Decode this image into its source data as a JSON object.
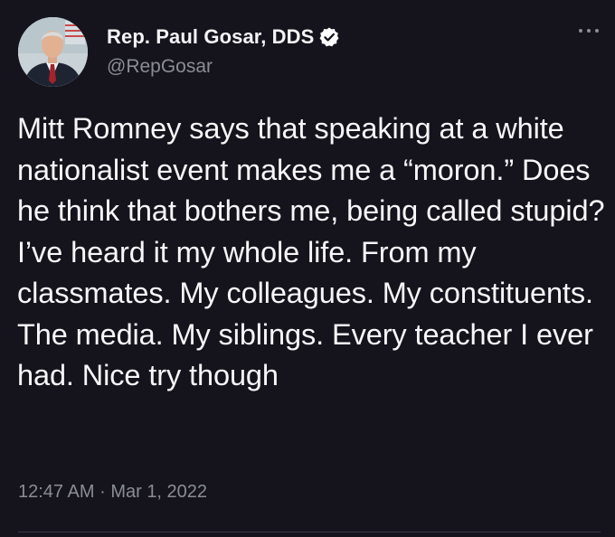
{
  "tweet": {
    "author": {
      "display_name": "Rep. Paul Gosar, DDS",
      "handle": "@RepGosar",
      "verified": true,
      "avatar_icon": "user-avatar-photo"
    },
    "more_icon": "more-options-icon",
    "text": "Mitt Romney says that speaking at a white nationalist event makes me a “moron.” Does he think that bothers me, being called stupid? I’ve heard it my whole life. From my classmates. My colleagues. My constituents. The media. My siblings. Every teacher I ever had. Nice try though",
    "time": "12:47 AM",
    "separator": "·",
    "date": "Mar 1, 2022"
  },
  "colors": {
    "background": "#15141d",
    "text": "#f7f7f9",
    "secondary_text": "#8b8d94",
    "verified_badge": "#ffffff"
  }
}
